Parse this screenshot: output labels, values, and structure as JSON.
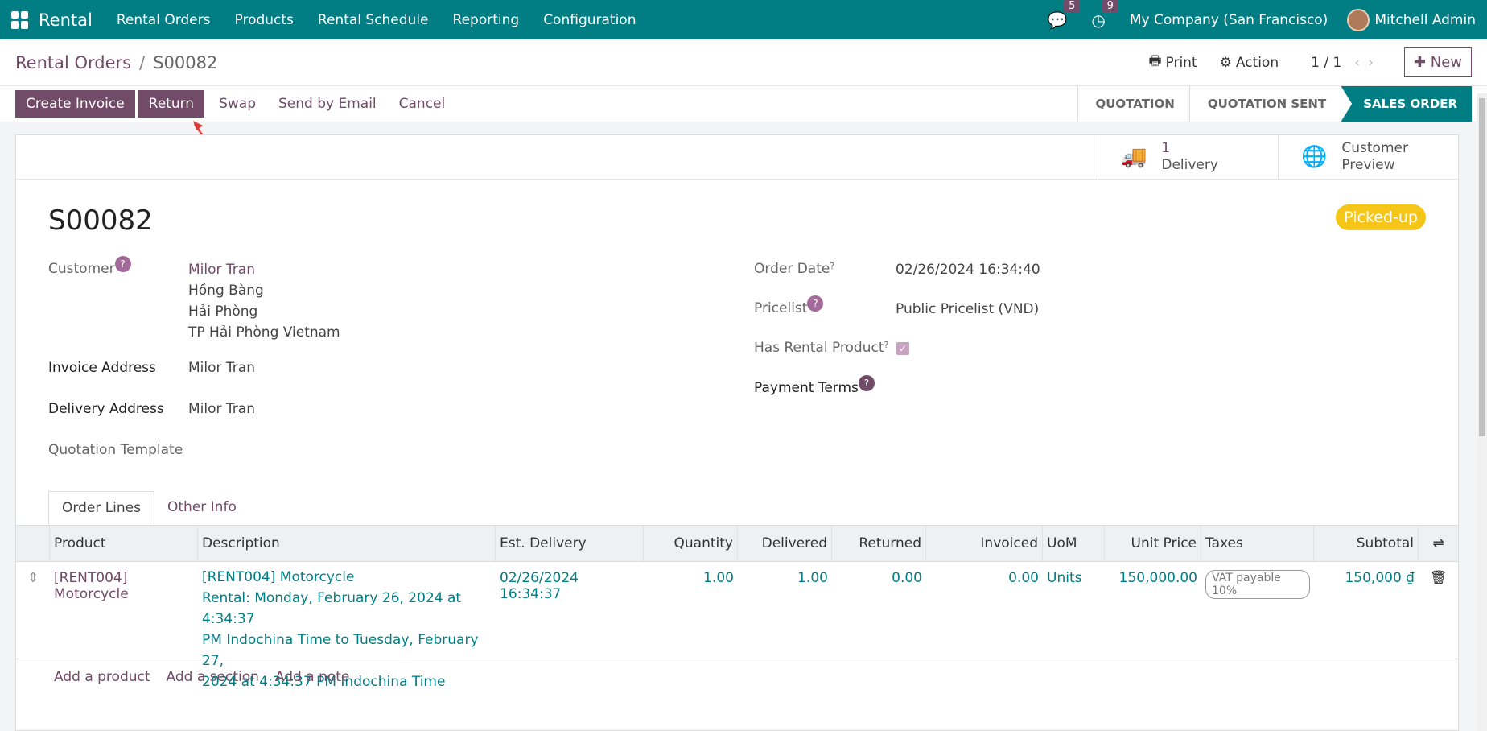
{
  "nav": {
    "app_name": "Rental",
    "menus": [
      "Rental Orders",
      "Products",
      "Rental Schedule",
      "Reporting",
      "Configuration"
    ],
    "messages_count": "5",
    "activities_count": "9",
    "company": "My Company (San Francisco)",
    "user": "Mitchell Admin"
  },
  "breadcrumb": {
    "parent": "Rental Orders",
    "separator": "/",
    "current": "S00082"
  },
  "controls": {
    "print": "Print",
    "action": "Action",
    "pager": "1 / 1",
    "new": "New"
  },
  "actions": {
    "create_invoice": "Create Invoice",
    "return": "Return",
    "swap": "Swap",
    "send_email": "Send by Email",
    "cancel": "Cancel"
  },
  "stages": [
    "QUOTATION",
    "QUOTATION SENT",
    "SALES ORDER"
  ],
  "smart_buttons": {
    "delivery_count": "1",
    "delivery_label": "Delivery",
    "preview_line1": "Customer",
    "preview_line2": "Preview"
  },
  "order": {
    "name": "S00082",
    "status": "Picked-up",
    "customer_label": "Customer",
    "customer_name": "Milor Tran",
    "customer_addr1": "Hồng Bàng",
    "customer_addr2": "Hải Phòng",
    "customer_addr3": "TP Hải Phòng Vietnam",
    "invoice_label": "Invoice Address",
    "invoice_value": "Milor Tran",
    "delivery_label": "Delivery Address",
    "delivery_value": "Milor Tran",
    "template_label": "Quotation Template",
    "order_date_label": "Order Date",
    "order_date_value": "02/26/2024 16:34:40",
    "pricelist_label": "Pricelist",
    "pricelist_value": "Public Pricelist (VND)",
    "rental_label": "Has Rental Product",
    "payment_label": "Payment Terms"
  },
  "tabs": [
    "Order Lines",
    "Other Info"
  ],
  "table": {
    "headers": [
      "Product",
      "Description",
      "Est. Delivery",
      "Quantity",
      "Delivered",
      "Returned",
      "Invoiced",
      "UoM",
      "Unit Price",
      "Taxes",
      "Subtotal"
    ],
    "row": {
      "product": "[RENT004] Motorcycle",
      "desc1": "[RENT004] Motorcycle",
      "desc2": "Rental: Monday, February 26, 2024 at 4:34:37",
      "desc3": "PM Indochina Time to Tuesday, February 27,",
      "desc4": "2024 at 4:34:37 PM Indochina Time",
      "est_delivery": "02/26/2024 16:34:37",
      "quantity": "1.00",
      "delivered": "1.00",
      "returned": "0.00",
      "invoiced": "0.00",
      "uom": "Units",
      "unit_price": "150,000.00",
      "tax": "VAT payable 10%",
      "subtotal": "150,000 ₫"
    },
    "add_product": "Add a product",
    "add_section": "Add a section",
    "add_note": "Add a note"
  }
}
